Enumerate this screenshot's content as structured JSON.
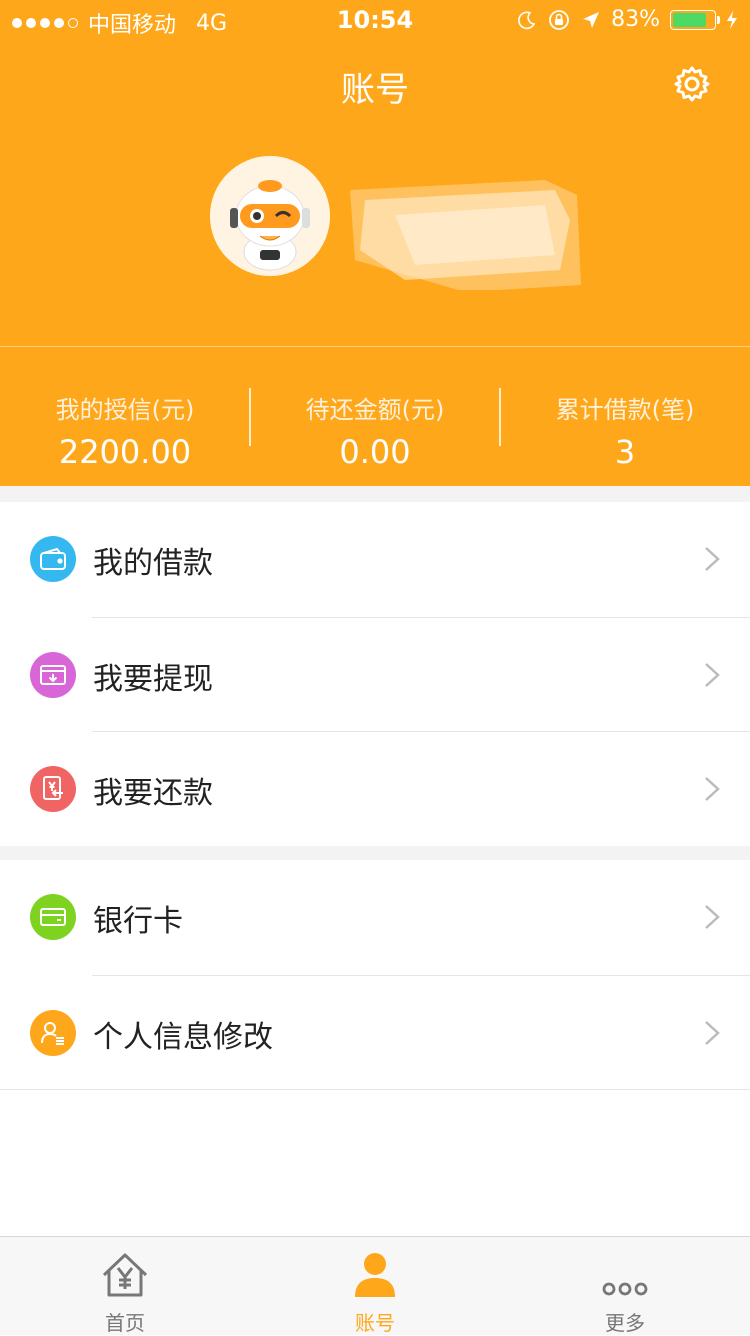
{
  "status_bar": {
    "carrier": "中国移动",
    "network": "4G",
    "time": "10:54",
    "battery_percent": "83%",
    "battery_level": 0.83
  },
  "header": {
    "title": "账号"
  },
  "stats": [
    {
      "label": "我的授信(元)",
      "value": "2200.00"
    },
    {
      "label": "待还金额(元)",
      "value": "0.00"
    },
    {
      "label": "累计借款(笔)",
      "value": "3"
    }
  ],
  "menu_group_1": [
    {
      "label": "我的借款",
      "icon": "wallet-icon",
      "color": "#35B8F0"
    },
    {
      "label": "我要提现",
      "icon": "withdraw-icon",
      "color": "#D866D6"
    },
    {
      "label": "我要还款",
      "icon": "repay-icon",
      "color": "#F06464"
    }
  ],
  "menu_group_2": [
    {
      "label": "银行卡",
      "icon": "bank-card-icon",
      "color": "#7ED321"
    },
    {
      "label": "个人信息修改",
      "icon": "profile-icon",
      "color": "#FFA71A"
    }
  ],
  "tabbar": {
    "tabs": [
      {
        "label": "首页",
        "icon": "home-icon"
      },
      {
        "label": "账号",
        "icon": "person-icon",
        "active": true
      },
      {
        "label": "更多",
        "icon": "more-icon"
      }
    ]
  },
  "colors": {
    "brand": "#FFA71A",
    "tab_inactive": "#777777",
    "background_gap": "#F3F3F3"
  }
}
